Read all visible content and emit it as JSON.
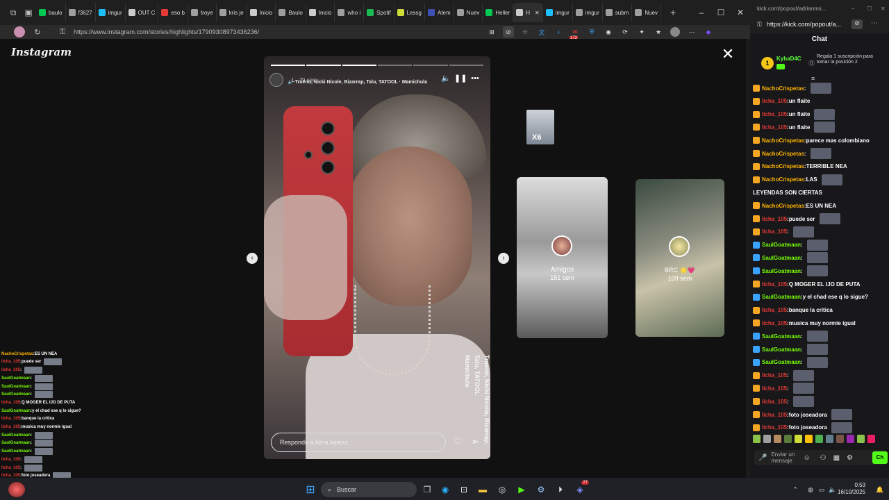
{
  "browser": {
    "tabs": [
      {
        "label": "baulo",
        "color": "#00c853"
      },
      {
        "label": "f3627",
        "color": "#9e9e9e"
      },
      {
        "label": "imgur",
        "color": "#1ebfff"
      },
      {
        "label": "OUT C",
        "color": "#cccccc"
      },
      {
        "label": "eso b",
        "color": "#e53935"
      },
      {
        "label": "troye",
        "color": "#9e9e9e"
      },
      {
        "label": "kris je",
        "color": "#9e9e9e"
      },
      {
        "label": "Inicio",
        "color": "#cccccc"
      },
      {
        "label": "Baulo",
        "color": "#9e9e9e"
      },
      {
        "label": "Inicio",
        "color": "#cccccc"
      },
      {
        "label": "who i",
        "color": "#9e9e9e"
      },
      {
        "label": "Spotif",
        "color": "#1db954"
      },
      {
        "label": "Lessg",
        "color": "#cddc39"
      },
      {
        "label": "Atem",
        "color": "#3f51b5"
      },
      {
        "label": "Nuev",
        "color": "#9e9e9e"
      },
      {
        "label": "Heller",
        "color": "#00c853"
      },
      {
        "label": "H",
        "color": "#cccccc"
      },
      {
        "label": "imgur",
        "color": "#1ebfff"
      },
      {
        "label": "imgur",
        "color": "#9e9e9e"
      },
      {
        "label": "subm",
        "color": "#9e9e9e"
      },
      {
        "label": "Nuev",
        "color": "#9e9e9e"
      }
    ],
    "url": "https://www.instagram.com/stories/highlights/17909308973436236/",
    "badge_count": "172"
  },
  "instagram": {
    "logo": "Instagram",
    "story": {
      "username": "L",
      "time": "79 sem",
      "music": "Trueno, Nicki Nicole, Bizarrap, Talu, TATOOL · Mamichula",
      "vertical_lines": [
        "Trueno, Nicki Nicole, Bizarrap,",
        "Talu, TATOOL",
        "Mamichula"
      ],
      "reply_placeholder": "Responde a licha.lopezz...",
      "progress_segments": 6,
      "progress_done": 3
    },
    "highlights": [
      {
        "title": "Amigos",
        "time": "151 sem"
      },
      {
        "title": "BRC 🌟💗",
        "time": "109 sem"
      }
    ],
    "small_thumb_label": "X6"
  },
  "kick": {
    "window_title": "kick.com/popout/adrianms...",
    "url": "https://kick.com/popout/a...",
    "chat_header": "Chat",
    "pinned": {
      "user": "KybaD4C",
      "count": "1",
      "text": "Regala 1 suscripción para tomar la posición 2"
    },
    "messages": [
      {
        "user": "NachoCrispetas",
        "color": "#ffb300",
        "text": "",
        "emote": true
      },
      {
        "user": "licha_105",
        "color": "#e53935",
        "text": "un flaite",
        "emote": false
      },
      {
        "user": "licha_105",
        "color": "#e53935",
        "text": "un flaite",
        "emote": true
      },
      {
        "user": "licha_105",
        "color": "#e53935",
        "text": "un flaite",
        "emote": true
      },
      {
        "user": "NachoCrispetas",
        "color": "#ffb300",
        "text": "parece mas colombiano",
        "emote": false
      },
      {
        "user": "NachoCrispetas",
        "color": "#ffb300",
        "text": "",
        "emote": true
      },
      {
        "user": "NachoCrispetas",
        "color": "#ffb300",
        "text": "TERRIBLE NEA",
        "emote": false
      },
      {
        "user": "NachoCrispetas",
        "color": "#ffb300",
        "text": "LAS",
        "emote": true
      },
      {
        "user": "",
        "color": "#ffffff",
        "text": "LEYENDAS SON CIERTAS",
        "emote": false
      },
      {
        "user": "NachoCrispetas",
        "color": "#ffb300",
        "text": "ES UN NEA",
        "emote": false
      },
      {
        "user": "licha_105",
        "color": "#e53935",
        "text": "puede ser",
        "emote": true
      },
      {
        "user": "licha_105",
        "color": "#e53935",
        "text": "",
        "emote": true
      },
      {
        "user": "SaulGoatmaan",
        "color": "#76ff03",
        "text": "",
        "emote": true
      },
      {
        "user": "SaulGoatmaan",
        "color": "#76ff03",
        "text": "",
        "emote": true
      },
      {
        "user": "SaulGoatmaan",
        "color": "#76ff03",
        "text": "",
        "emote": true
      },
      {
        "user": "licha_105",
        "color": "#e53935",
        "text": "Q MOGER EL IJO DE PUTA",
        "emote": false
      },
      {
        "user": "SaulGoatmaan",
        "color": "#76ff03",
        "text": "y el chad ese q lo sigue?",
        "emote": false
      },
      {
        "user": "licha_105",
        "color": "#e53935",
        "text": "banque la critica",
        "emote": false
      },
      {
        "user": "licha_105",
        "color": "#e53935",
        "text": "musica muy normie igual",
        "emote": false
      },
      {
        "user": "SaulGoatmaan",
        "color": "#76ff03",
        "text": "",
        "emote": true
      },
      {
        "user": "SaulGoatmaan",
        "color": "#76ff03",
        "text": "",
        "emote": true
      },
      {
        "user": "SaulGoatmaan",
        "color": "#76ff03",
        "text": "",
        "emote": true
      },
      {
        "user": "licha_105",
        "color": "#e53935",
        "text": "",
        "emote": true
      },
      {
        "user": "licha_105",
        "color": "#e53935",
        "text": "",
        "emote": true
      },
      {
        "user": "licha_105",
        "color": "#e53935",
        "text": "",
        "emote": true
      },
      {
        "user": "licha_105",
        "color": "#e53935",
        "text": "foto joseadora",
        "emote": true
      },
      {
        "user": "licha_105",
        "color": "#e53935",
        "text": "foto joseadora",
        "emote": true
      }
    ],
    "input_placeholder": "Enviar un mensaje",
    "chat_button": "Ch"
  },
  "overlay_chat": [
    {
      "user": "NachoCrispetas",
      "color": "#ffb300",
      "text": "ES UN NEA",
      "emote": false
    },
    {
      "user": "licha_105",
      "color": "#e53935",
      "text": "puede ser",
      "emote": true
    },
    {
      "user": "licha_105",
      "color": "#e53935",
      "text": "",
      "emote": true
    },
    {
      "user": "SaulGoatmaan",
      "color": "#76ff03",
      "text": "",
      "emote": true
    },
    {
      "user": "SaulGoatmaan",
      "color": "#76ff03",
      "text": "",
      "emote": true
    },
    {
      "user": "SaulGoatmaan",
      "color": "#76ff03",
      "text": "",
      "emote": true
    },
    {
      "user": "licha_105",
      "color": "#e53935",
      "text": "Q MOGER EL IJO DE PUTA",
      "emote": false
    },
    {
      "user": "SaulGoatmaan",
      "color": "#76ff03",
      "text": "y el chad ese q lo sigue?",
      "emote": false
    },
    {
      "user": "licha_105",
      "color": "#e53935",
      "text": "banque la critica",
      "emote": false
    },
    {
      "user": "licha_105",
      "color": "#e53935",
      "text": "musica muy normie igual",
      "emote": false
    },
    {
      "user": "SaulGoatmaan",
      "color": "#76ff03",
      "text": "",
      "emote": true
    },
    {
      "user": "SaulGoatmaan",
      "color": "#76ff03",
      "text": "",
      "emote": true
    },
    {
      "user": "SaulGoatmaan",
      "color": "#76ff03",
      "text": "",
      "emote": true
    },
    {
      "user": "licha_105",
      "color": "#e53935",
      "text": "",
      "emote": true
    },
    {
      "user": "licha_105",
      "color": "#e53935",
      "text": "",
      "emote": true
    },
    {
      "user": "licha_105",
      "color": "#e53935",
      "text": "foto joseadora",
      "emote": true
    },
    {
      "user": "licha_105",
      "color": "#e53935",
      "text": "foto joseadora",
      "emote": true
    }
  ],
  "taskbar": {
    "search_label": "Buscar",
    "time": "0:53",
    "date": "16/10/2025",
    "balloon_count": "27"
  }
}
